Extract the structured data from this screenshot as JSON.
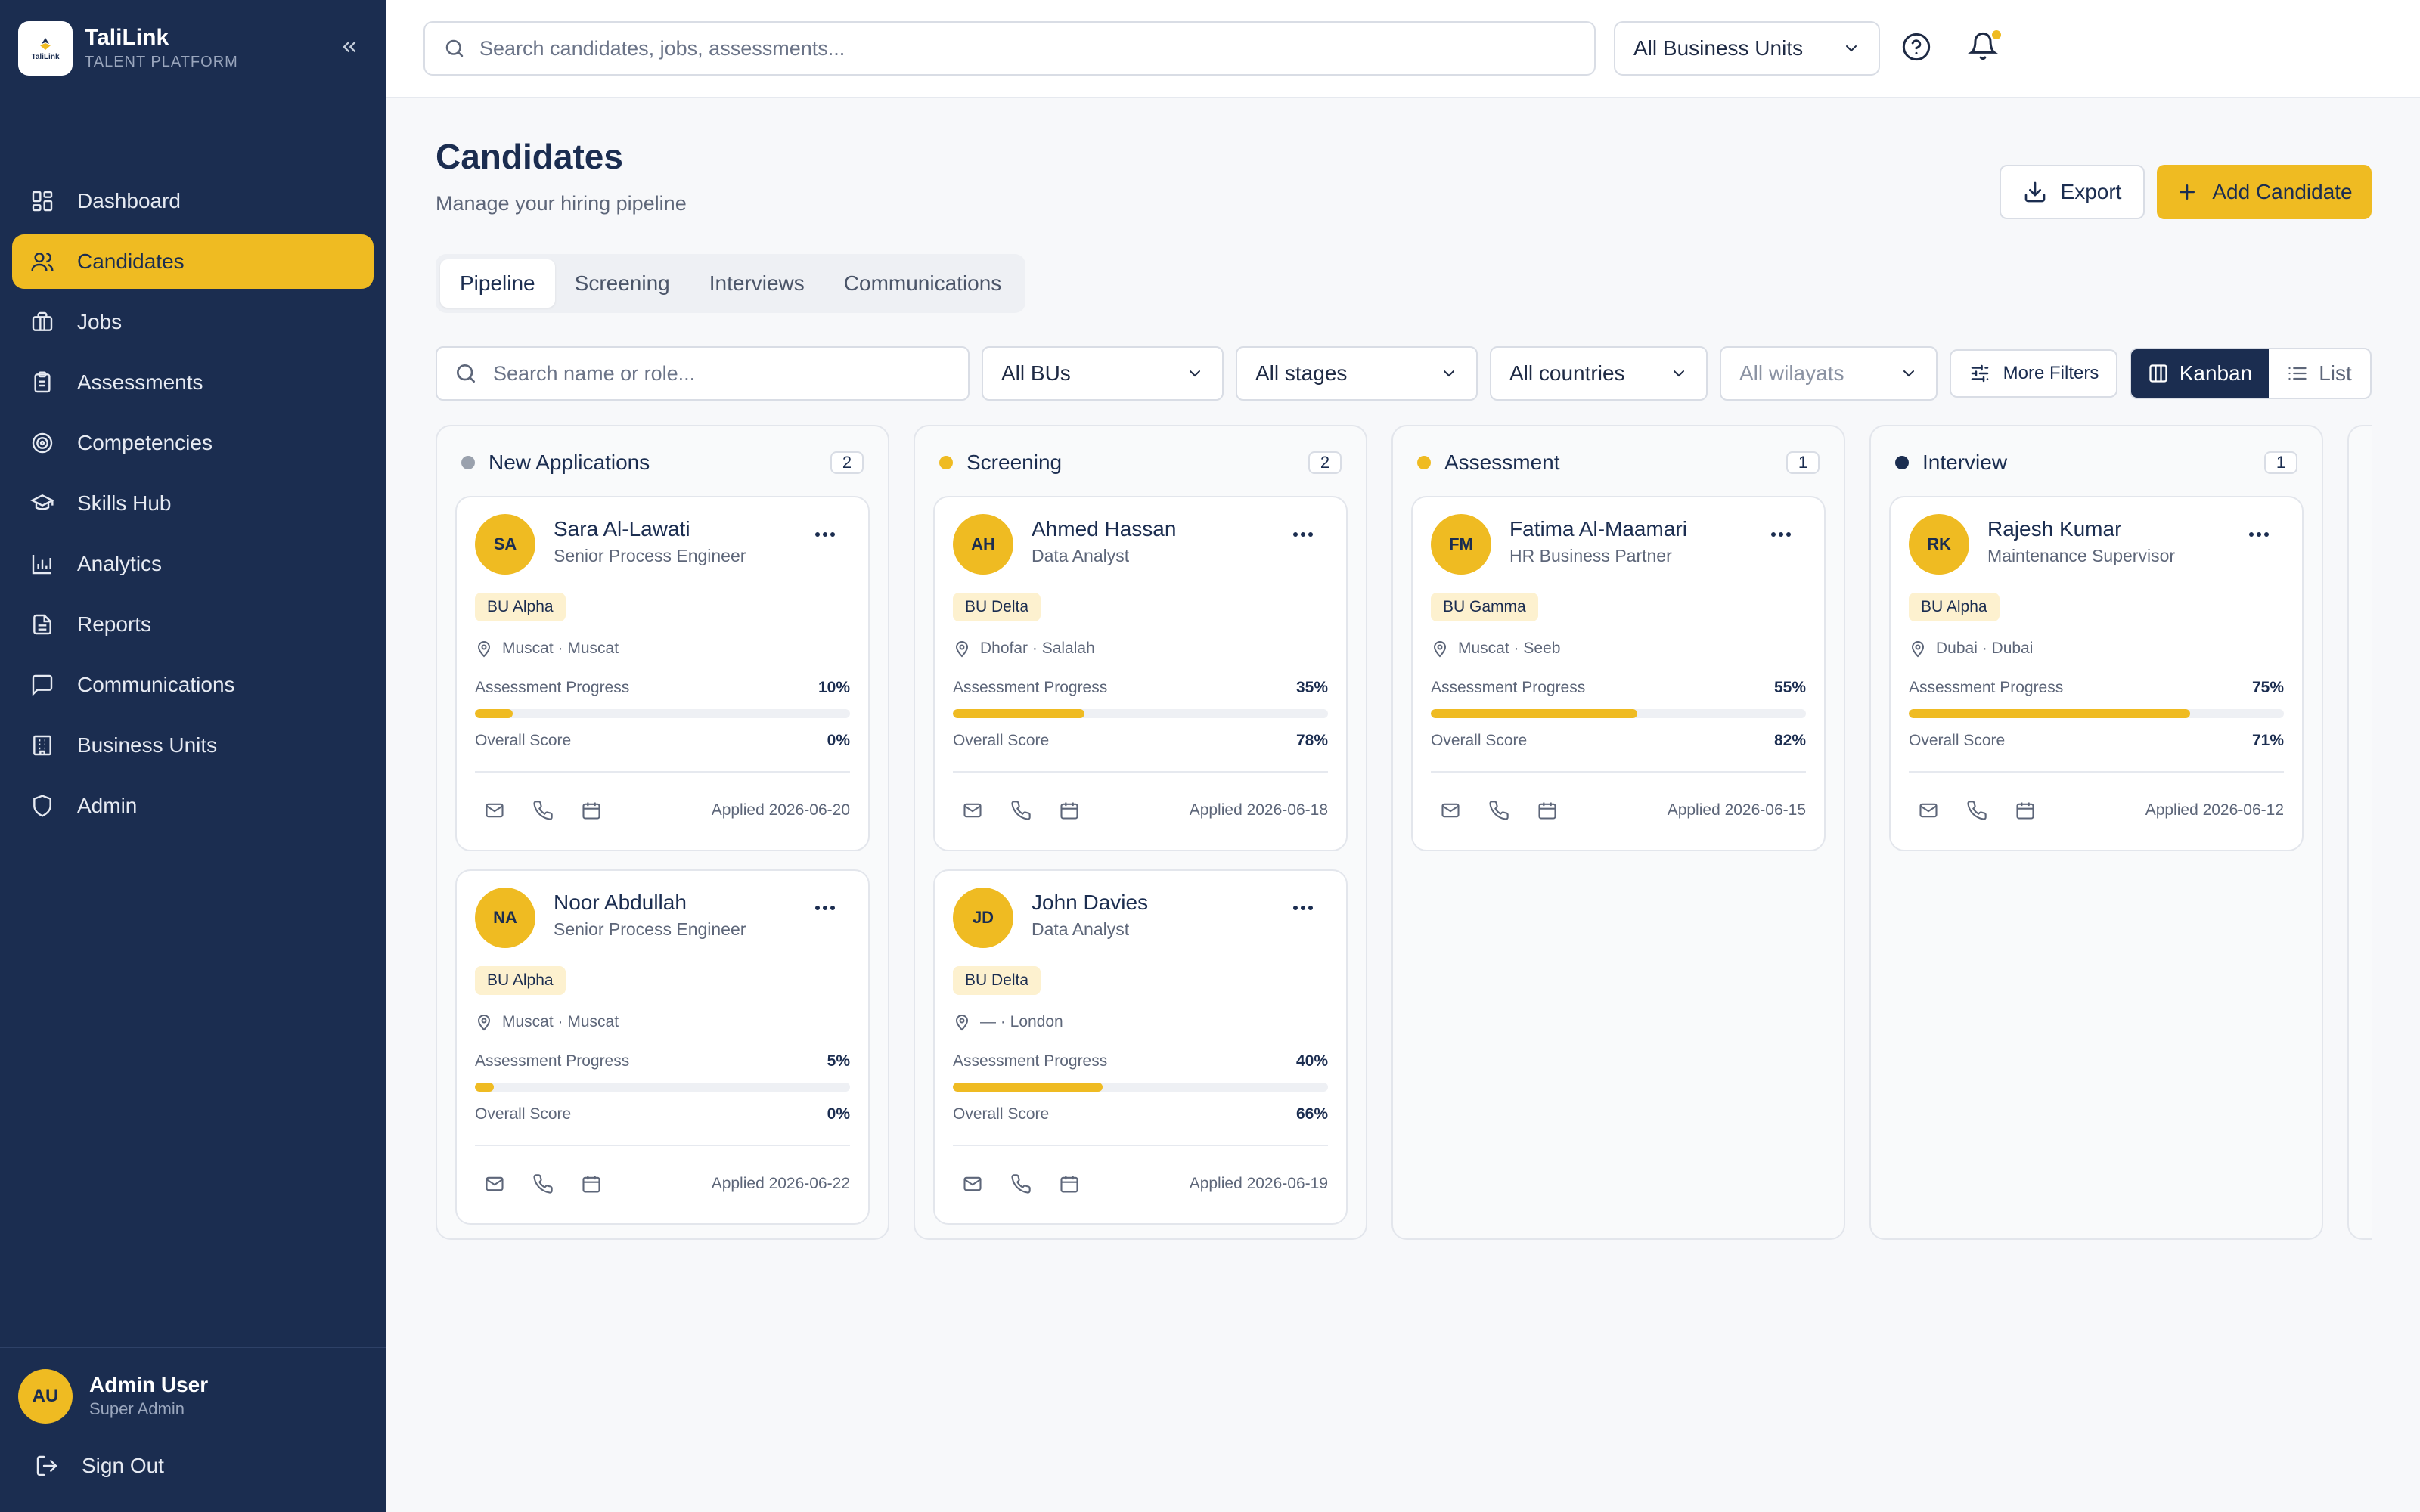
{
  "app": {
    "name": "TaliLink",
    "subtitle": "TALENT PLATFORM",
    "logo_text": "TaliLink"
  },
  "sidebar": {
    "items": [
      {
        "label": "Dashboard",
        "icon": "dashboard-icon",
        "active": false
      },
      {
        "label": "Candidates",
        "icon": "users-icon",
        "active": true
      },
      {
        "label": "Jobs",
        "icon": "briefcase-icon",
        "active": false
      },
      {
        "label": "Assessments",
        "icon": "clipboard-icon",
        "active": false
      },
      {
        "label": "Competencies",
        "icon": "target-icon",
        "active": false
      },
      {
        "label": "Skills Hub",
        "icon": "graduation-cap-icon",
        "active": false
      },
      {
        "label": "Analytics",
        "icon": "bar-chart-icon",
        "active": false
      },
      {
        "label": "Reports",
        "icon": "file-text-icon",
        "active": false
      },
      {
        "label": "Communications",
        "icon": "message-square-icon",
        "active": false
      },
      {
        "label": "Business Units",
        "icon": "building-icon",
        "active": false
      },
      {
        "label": "Admin",
        "icon": "shield-icon",
        "active": false
      }
    ],
    "user": {
      "initials": "AU",
      "name": "Admin User",
      "role": "Super Admin"
    },
    "sign_out": "Sign Out"
  },
  "topbar": {
    "search_placeholder": "Search candidates, jobs, assessments...",
    "business_unit": "All Business Units"
  },
  "page": {
    "title": "Candidates",
    "subtitle": "Manage your hiring pipeline",
    "export_label": "Export",
    "add_label": "Add Candidate"
  },
  "tabs": [
    {
      "label": "Pipeline",
      "active": true
    },
    {
      "label": "Screening",
      "active": false
    },
    {
      "label": "Interviews",
      "active": false
    },
    {
      "label": "Communications",
      "active": false
    }
  ],
  "filters": {
    "search_placeholder": "Search name or role...",
    "bu": "All BUs",
    "stage": "All stages",
    "country": "All countries",
    "wilayat": "All wilayats",
    "more": "More Filters",
    "view_kanban": "Kanban",
    "view_list": "List"
  },
  "labels": {
    "assessment_progress": "Assessment Progress",
    "overall_score": "Overall Score"
  },
  "colors": {
    "accent": "#efbb22",
    "navy": "#1b2d50",
    "new_dot": "#9aa1ad",
    "screening_dot": "#efbb22",
    "assessment_dot": "#efbb22",
    "interview_dot": "#1b2d50"
  },
  "columns": [
    {
      "title": "New Applications",
      "count": "2",
      "dot": "#9aa1ad",
      "cards": [
        {
          "initials": "SA",
          "name": "Sara Al-Lawati",
          "role": "Senior Process Engineer",
          "bu": "BU Alpha",
          "location": "Muscat · Muscat",
          "progress_label": "10%",
          "progress": 10,
          "score": "0%",
          "applied": "Applied 2026-06-20"
        },
        {
          "initials": "NA",
          "name": "Noor Abdullah",
          "role": "Senior Process Engineer",
          "bu": "BU Alpha",
          "location": "Muscat · Muscat",
          "progress_label": "5%",
          "progress": 5,
          "score": "0%",
          "applied": "Applied 2026-06-22"
        }
      ]
    },
    {
      "title": "Screening",
      "count": "2",
      "dot": "#efbb22",
      "cards": [
        {
          "initials": "AH",
          "name": "Ahmed Hassan",
          "role": "Data Analyst",
          "bu": "BU Delta",
          "location": "Dhofar · Salalah",
          "progress_label": "35%",
          "progress": 35,
          "score": "78%",
          "applied": "Applied 2026-06-18"
        },
        {
          "initials": "JD",
          "name": "John Davies",
          "role": "Data Analyst",
          "bu": "BU Delta",
          "location": "— · London",
          "progress_label": "40%",
          "progress": 40,
          "score": "66%",
          "applied": "Applied 2026-06-19"
        }
      ]
    },
    {
      "title": "Assessment",
      "count": "1",
      "dot": "#efbb22",
      "cards": [
        {
          "initials": "FM",
          "name": "Fatima Al-Maamari",
          "role": "HR Business Partner",
          "bu": "BU Gamma",
          "location": "Muscat · Seeb",
          "progress_label": "55%",
          "progress": 55,
          "score": "82%",
          "applied": "Applied 2026-06-15"
        }
      ]
    },
    {
      "title": "Interview",
      "count": "1",
      "dot": "#1b2d50",
      "cards": [
        {
          "initials": "RK",
          "name": "Rajesh Kumar",
          "role": "Maintenance Supervisor",
          "bu": "BU Alpha",
          "location": "Dubai · Dubai",
          "progress_label": "75%",
          "progress": 75,
          "score": "71%",
          "applied": "Applied 2026-06-12"
        }
      ]
    }
  ]
}
